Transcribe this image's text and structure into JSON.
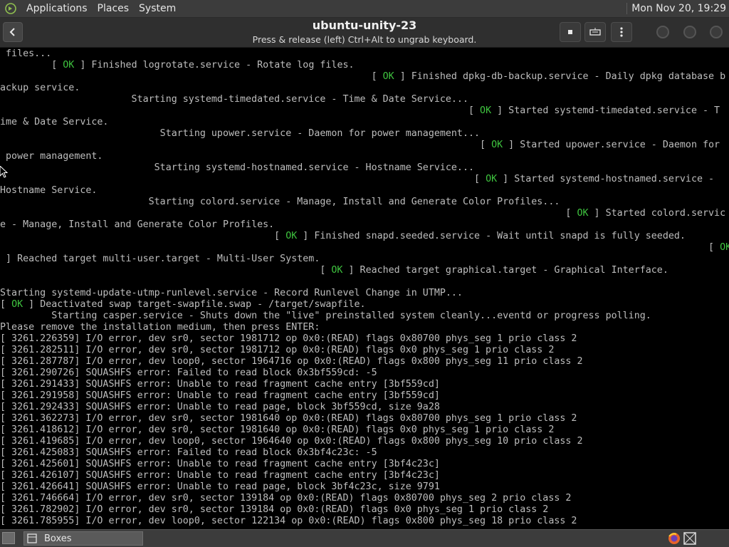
{
  "topbar": {
    "menus": [
      "Applications",
      "Places",
      "System"
    ],
    "clock": "Mon Nov 20, 19:29"
  },
  "window": {
    "title": "ubuntu-unity-23",
    "subtitle": "Press & release (left) Ctrl+Alt to ungrab keyboard."
  },
  "console": {
    "lines": [
      {
        "pre": " files...",
        "ok": false
      },
      {
        "pre": "         [ ",
        "ok": true,
        "post": " ] Finished logrotate.service - Rotate log files."
      },
      {
        "pre": "                                                                 [ ",
        "ok": true,
        "post": " ] Finished dpkg-db-backup.service - Daily dpkg database b"
      },
      {
        "pre": "ackup service.",
        "ok": false
      },
      {
        "pre": "                       Starting systemd-timedated.service - Time & Date Service...",
        "ok": false
      },
      {
        "pre": "                                                                                  [ ",
        "ok": true,
        "post": " ] Started systemd-timedated.service - T"
      },
      {
        "pre": "ime & Date Service.",
        "ok": false
      },
      {
        "pre": "                            Starting upower.service - Daemon for power management...",
        "ok": false
      },
      {
        "pre": "                                                                                    [ ",
        "ok": true,
        "post": " ] Started upower.service - Daemon for"
      },
      {
        "pre": " power management.",
        "ok": false
      },
      {
        "pre": "                           Starting systemd-hostnamed.service - Hostname Service...",
        "ok": false
      },
      {
        "pre": "                                                                                   [ ",
        "ok": true,
        "post": " ] Started systemd-hostnamed.service -"
      },
      {
        "pre": "Hostname Service.",
        "ok": false
      },
      {
        "pre": "                          Starting colord.service - Manage, Install and Generate Color Profiles...",
        "ok": false
      },
      {
        "pre": "                                                                                                   [ ",
        "ok": true,
        "post": " ] Started colord.servic"
      },
      {
        "pre": "e - Manage, Install and Generate Color Profiles.",
        "ok": false
      },
      {
        "pre": "                                                [ ",
        "ok": true,
        "post": " ] Finished snapd.seeded.service - Wait until snapd is fully seeded."
      },
      {
        "pre": "                                                                                                                            [ ",
        "ok": true,
        "post": ""
      },
      {
        "pre": " ] Reached target multi-user.target - Multi-User System.",
        "ok": false
      },
      {
        "pre": "                                                        [ ",
        "ok": true,
        "post": " ] Reached target graphical.target - Graphical Interface."
      },
      {
        "pre": "",
        "ok": false
      },
      {
        "pre": "Starting systemd-update-utmp-runlevel.service - Record Runlevel Change in UTMP...",
        "ok": false
      },
      {
        "pre": "[ ",
        "ok": true,
        "post": " ] Deactivated swap target-swapfile.swap - /target/swapfile."
      },
      {
        "pre": "         Starting casper.service - Shuts down the \"live\" preinstalled system cleanly...eventd or progress polling.",
        "ok": false
      },
      {
        "pre": "Please remove the installation medium, then press ENTER:",
        "ok": false
      },
      {
        "pre": "[ 3261.226359] I/O error, dev sr0, sector 1981712 op 0x0:(READ) flags 0x80700 phys_seg 1 prio class 2",
        "ok": false
      },
      {
        "pre": "[ 3261.282511] I/O error, dev sr0, sector 1981712 op 0x0:(READ) flags 0x0 phys_seg 1 prio class 2",
        "ok": false
      },
      {
        "pre": "[ 3261.287787] I/O error, dev loop0, sector 1964716 op 0x0:(READ) flags 0x800 phys_seg 11 prio class 2",
        "ok": false
      },
      {
        "pre": "[ 3261.290726] SQUASHFS error: Failed to read block 0x3bf559cd: -5",
        "ok": false
      },
      {
        "pre": "[ 3261.291433] SQUASHFS error: Unable to read fragment cache entry [3bf559cd]",
        "ok": false
      },
      {
        "pre": "[ 3261.291958] SQUASHFS error: Unable to read fragment cache entry [3bf559cd]",
        "ok": false
      },
      {
        "pre": "[ 3261.292433] SQUASHFS error: Unable to read page, block 3bf559cd, size 9a28",
        "ok": false
      },
      {
        "pre": "[ 3261.362273] I/O error, dev sr0, sector 1981640 op 0x0:(READ) flags 0x80700 phys_seg 1 prio class 2",
        "ok": false
      },
      {
        "pre": "[ 3261.418612] I/O error, dev sr0, sector 1981640 op 0x0:(READ) flags 0x0 phys_seg 1 prio class 2",
        "ok": false
      },
      {
        "pre": "[ 3261.419685] I/O error, dev loop0, sector 1964640 op 0x0:(READ) flags 0x800 phys_seg 10 prio class 2",
        "ok": false
      },
      {
        "pre": "[ 3261.425083] SQUASHFS error: Failed to read block 0x3bf4c23c: -5",
        "ok": false
      },
      {
        "pre": "[ 3261.425601] SQUASHFS error: Unable to read fragment cache entry [3bf4c23c]",
        "ok": false
      },
      {
        "pre": "[ 3261.426107] SQUASHFS error: Unable to read fragment cache entry [3bf4c23c]",
        "ok": false
      },
      {
        "pre": "[ 3261.426641] SQUASHFS error: Unable to read page, block 3bf4c23c, size 9791",
        "ok": false
      },
      {
        "pre": "[ 3261.746664] I/O error, dev sr0, sector 139184 op 0x0:(READ) flags 0x80700 phys_seg 2 prio class 2",
        "ok": false
      },
      {
        "pre": "[ 3261.782902] I/O error, dev sr0, sector 139184 op 0x0:(READ) flags 0x0 phys_seg 1 prio class 2",
        "ok": false
      },
      {
        "pre": "[ 3261.785955] I/O error, dev loop0, sector 122134 op 0x0:(READ) flags 0x800 phys_seg 18 prio class 2",
        "ok": false
      }
    ],
    "ok_text": "OK"
  },
  "taskbar": {
    "task_label": "Boxes"
  },
  "colors": {
    "ok_green": "#3fc43f",
    "console_text": "#bdbdbd",
    "console_bg": "#000000"
  }
}
